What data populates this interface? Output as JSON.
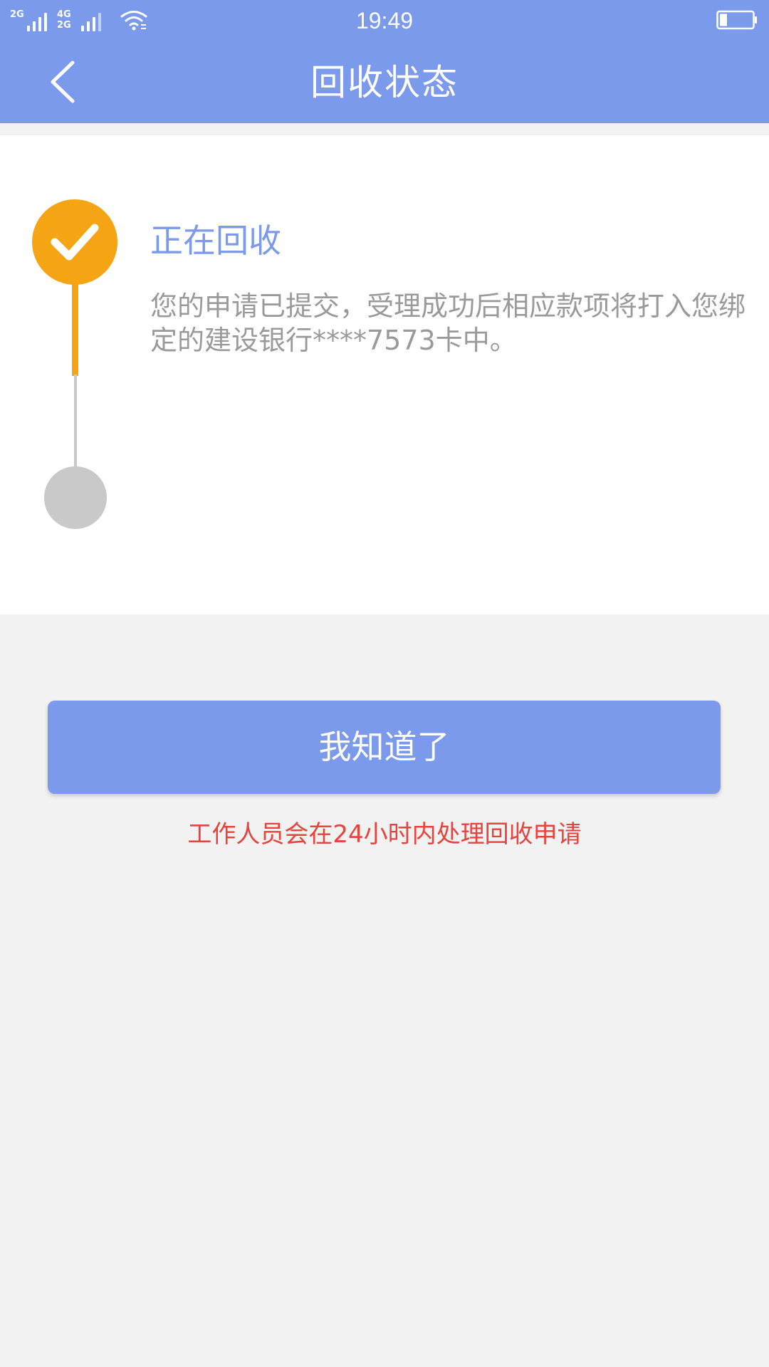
{
  "status_bar": {
    "signal1_label": "2G",
    "signal2_label_top": "4G",
    "signal2_label_bottom": "2G",
    "time": "19:49"
  },
  "nav": {
    "title": "回收状态"
  },
  "progress": {
    "current_step_title": "正在回收",
    "current_step_desc": "您的申请已提交，受理成功后相应款项将打入您绑定的建设银行****7573卡中。"
  },
  "actions": {
    "confirm_label": "我知道了"
  },
  "notice": {
    "text": "工作人员会在24小时内处理回收申请"
  },
  "icons": {
    "back": "chevron-left-icon",
    "check": "check-icon",
    "wifi": "wifi-icon",
    "battery": "battery-icon"
  },
  "colors": {
    "primary": "#7b9aeb",
    "accent": "#f5a513",
    "inactive": "#c9c9c9",
    "notice": "#e8433c"
  }
}
